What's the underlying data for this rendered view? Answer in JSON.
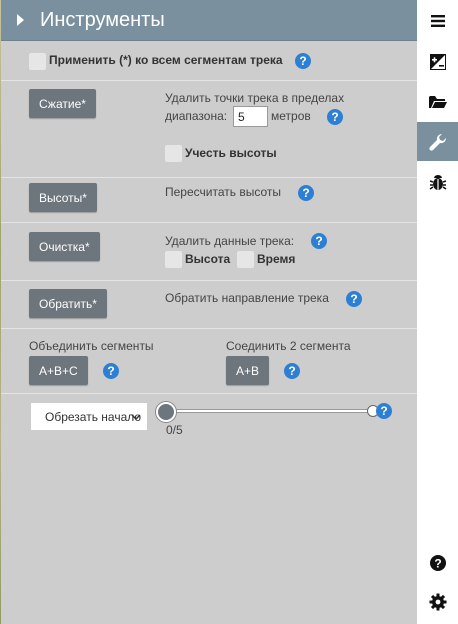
{
  "header": {
    "title": "Инструменты"
  },
  "apply_all": {
    "label": "Применить (*) ко всем сегментам трека"
  },
  "simplify": {
    "button": "Сжатие*",
    "desc_line1": "Удалить точки трека в пределах",
    "desc_prefix": "диапазона:",
    "value": "5",
    "unit": "метров",
    "elevation_label": "Учесть высоты"
  },
  "elevations": {
    "button": "Высоты*",
    "desc": "Пересчитать высоты"
  },
  "clean": {
    "button": "Очистка*",
    "desc": "Удалить данные трека:",
    "elevation_label": "Высота",
    "time_label": "Время"
  },
  "reverse": {
    "button": "Обратить*",
    "desc": "Обратить направление трека"
  },
  "merge": {
    "title": "Объединить сегменты",
    "button": "A+B+C",
    "join_title": "Соединить 2 сегмента",
    "join_button": "A+B"
  },
  "crop": {
    "selected": "Обрезать начало",
    "slider_value": 0,
    "slider_max": 5,
    "slider_label": "0/5"
  },
  "colors": {
    "header": "#7a909e",
    "panel": "#cdcdcd",
    "button": "#6d757d",
    "help": "#2d7fd4"
  },
  "sidebar_icons": [
    "menu-icon",
    "image-icon",
    "folder-open-icon",
    "wrench-icon",
    "bug-icon",
    "question-circle-icon",
    "gear-icon"
  ]
}
